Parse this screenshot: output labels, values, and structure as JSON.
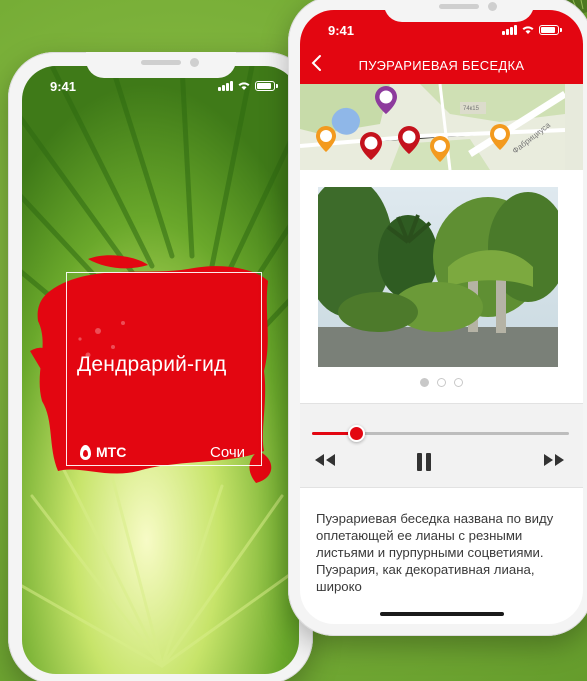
{
  "left_phone": {
    "status_time": "9:41",
    "app_title": "Дендрарий-гид",
    "brand": "МТС",
    "city": "Сочи"
  },
  "right_phone": {
    "status_time": "9:41",
    "header_title": "ПУЭРАРИЕВАЯ БЕСЕДКА",
    "map": {
      "street_label": "Фабрициуса",
      "building_label": "74к15"
    },
    "gallery": {
      "slides": 3,
      "active_slide": 1
    },
    "player": {
      "progress": 0.17
    },
    "description": "Пуэрариевая беседка названа по виду оплетающей ее лианы с резными листьями и пурпурными соцветиями. Пуэрария, как декоративная лиана, широко"
  },
  "colors": {
    "brand_red": "#e30611",
    "background_green": "#76ad36"
  },
  "icons": [
    "back-chevron-icon",
    "rewind-icon",
    "pause-icon",
    "fast-forward-icon",
    "map-pin-icon",
    "wifi-icon",
    "battery-icon",
    "signal-icon"
  ]
}
